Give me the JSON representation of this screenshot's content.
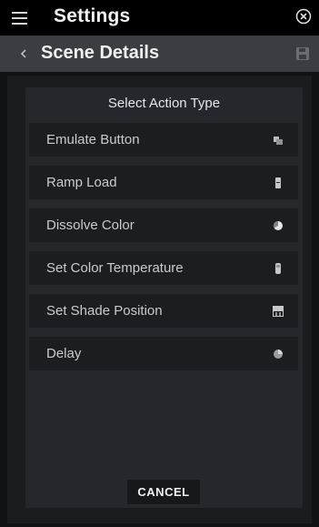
{
  "header": {
    "title": "Settings"
  },
  "subheader": {
    "title": "Scene Details"
  },
  "dialog": {
    "title": "Select Action Type",
    "options": [
      {
        "label": "Emulate Button",
        "icon": "button-icon"
      },
      {
        "label": "Ramp Load",
        "icon": "load-icon"
      },
      {
        "label": "Dissolve Color",
        "icon": "color-icon"
      },
      {
        "label": "Set Color Temperature",
        "icon": "temperature-icon"
      },
      {
        "label": "Set Shade Position",
        "icon": "shade-icon"
      },
      {
        "label": "Delay",
        "icon": "delay-icon"
      }
    ],
    "cancel_label": "CANCEL"
  },
  "colors": {
    "topbar": "#000000",
    "subbar": "#3a3d42",
    "modal": "#24272c",
    "option_row": "#1b1d21",
    "text": "#c9cbcf"
  }
}
